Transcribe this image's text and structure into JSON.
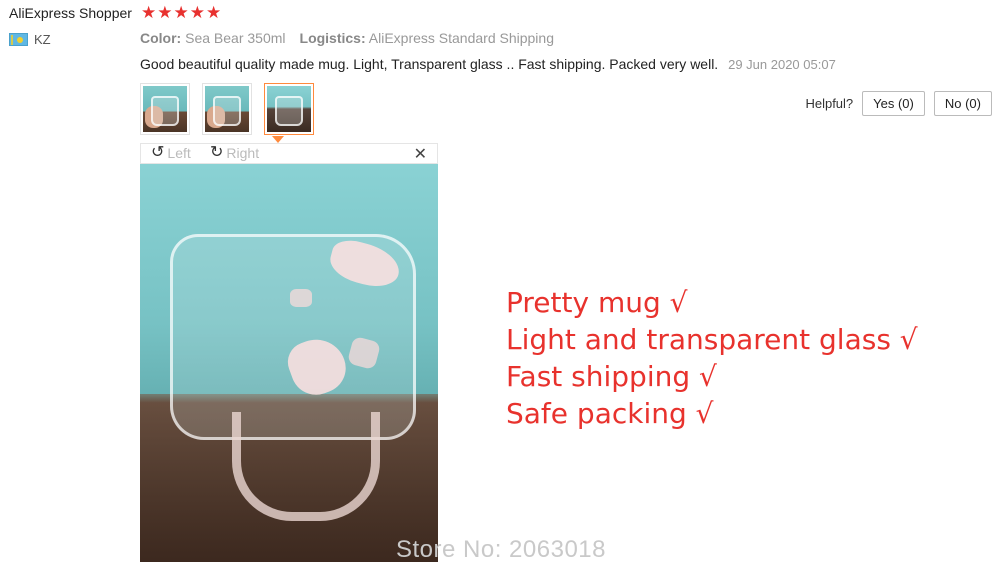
{
  "review": {
    "reviewer": "AliExpress Shopper",
    "rating": 5,
    "stars": [
      "★",
      "★",
      "★",
      "★",
      "★"
    ],
    "country_code": "KZ",
    "color_label": "Color:",
    "color_value": "Sea Bear 350ml",
    "logistics_label": "Logistics:",
    "logistics_value": "AliExpress Standard Shipping",
    "text": "Good beautiful quality made mug. Light, Transparent glass .. Fast shipping. Packed very well.",
    "date": "29 Jun 2020 05:07"
  },
  "helpful": {
    "label": "Helpful?",
    "yes_label": "Yes (0)",
    "no_label": "No (0)"
  },
  "viewer": {
    "rotate_left_label": "Left",
    "rotate_right_label": "Right",
    "rotate_left_icon": "↺",
    "rotate_right_icon": "↻",
    "close_icon": "✕"
  },
  "annotations": [
    "Pretty mug √",
    "Light and transparent glass √",
    "Fast shipping √",
    "Safe packing √"
  ],
  "watermark": "Store No: 2063018",
  "colors": {
    "star": "#e8312f",
    "annotation": "#e8322d",
    "active_thumb_border": "#ff8a3d",
    "watermark": "#c9c9c9"
  }
}
